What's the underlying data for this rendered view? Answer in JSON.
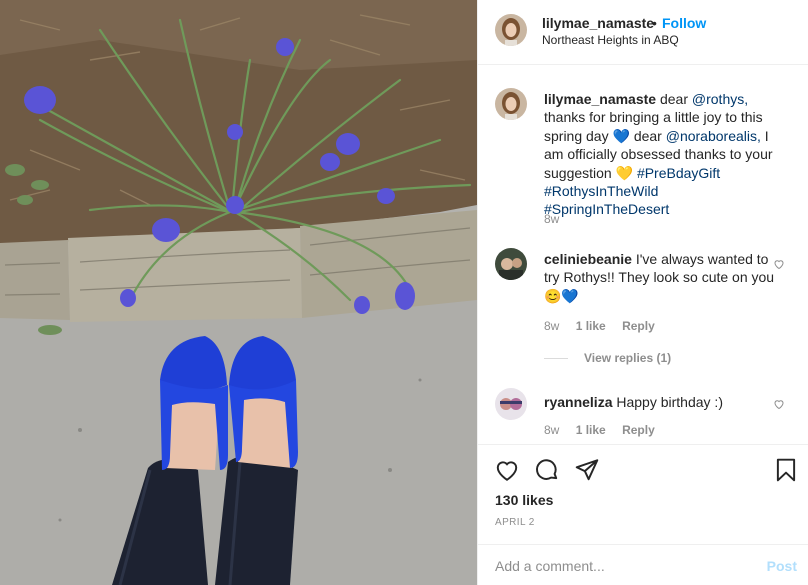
{
  "header": {
    "username": "lilymae_namaste",
    "separator": "•",
    "follow_label": "Follow",
    "location": "Northeast Heights in ABQ"
  },
  "caption": {
    "username": "lilymae_namaste",
    "text_1": "dear",
    "mention_1": "@rothys,",
    "text_2": "thanks for bringing a little joy to this spring day",
    "emoji_1": "💙",
    "text_3": "dear",
    "mention_2": "@noraborealis,",
    "text_4": "I am officially obsessed thanks to your suggestion",
    "emoji_2": "💛",
    "hashtag_1": "#PreBdayGift",
    "hashtag_2": "#RothysInTheWild",
    "hashtag_3": "#SpringInTheDesert",
    "age": "8w"
  },
  "comments": [
    {
      "username": "celiniebeanie",
      "text": "I've always wanted to try Rothys!! They look so cute on you",
      "emoji": "😊💙",
      "age": "8w",
      "likes": "1 like",
      "reply_label": "Reply",
      "view_replies": "View replies (1)"
    },
    {
      "username": "ryanneliza",
      "text": "Happy birthday :)",
      "age": "8w",
      "likes": "1 like",
      "reply_label": "Reply"
    }
  ],
  "actions": {
    "icons": [
      "heart-icon",
      "comment-icon",
      "share-icon",
      "bookmark-icon"
    ],
    "likes": "130 likes",
    "date": "APRIL 2"
  },
  "add_comment": {
    "placeholder": "Add a comment...",
    "post_label": "Post"
  },
  "colors": {
    "link": "#00376b",
    "follow": "#0095f6",
    "post_disabled": "#b2dffc",
    "muted": "#8e8e8e",
    "shoe_blue": "#1f3fd6"
  }
}
